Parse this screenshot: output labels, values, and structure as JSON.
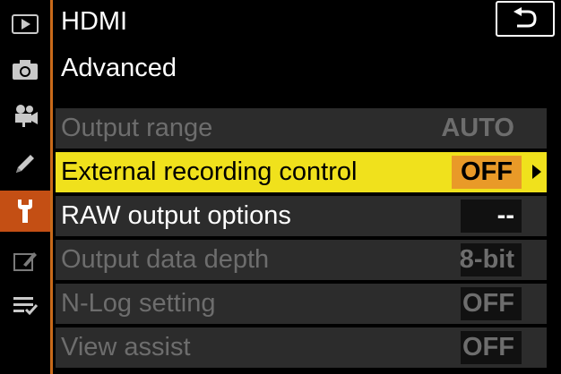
{
  "header": {
    "title": "HDMI",
    "subtitle": "Advanced"
  },
  "sidebar": {
    "items": [
      {
        "icon": "playback-icon",
        "active": false
      },
      {
        "icon": "camera-icon",
        "active": false
      },
      {
        "icon": "movie-camera-icon",
        "active": false
      },
      {
        "icon": "pencil-icon",
        "active": false
      },
      {
        "icon": "wrench-icon",
        "active": true
      },
      {
        "icon": "retouch-icon",
        "active": false
      },
      {
        "icon": "my-menu-icon",
        "active": false
      }
    ]
  },
  "menu": {
    "items": [
      {
        "label": "Output range",
        "value": "AUTO",
        "state": "disabled"
      },
      {
        "label": "External recording control",
        "value": "OFF",
        "state": "selected"
      },
      {
        "label": "RAW output options",
        "value": "--",
        "state": "enabled"
      },
      {
        "label": "Output data depth",
        "value": "8-bit",
        "state": "disabled"
      },
      {
        "label": "N-Log setting",
        "value": "OFF",
        "state": "disabled"
      },
      {
        "label": "View assist",
        "value": "OFF",
        "state": "disabled"
      }
    ]
  },
  "colors": {
    "accent": "#c44f14",
    "highlight": "#f0e11c",
    "value_highlight": "#e99a28"
  }
}
